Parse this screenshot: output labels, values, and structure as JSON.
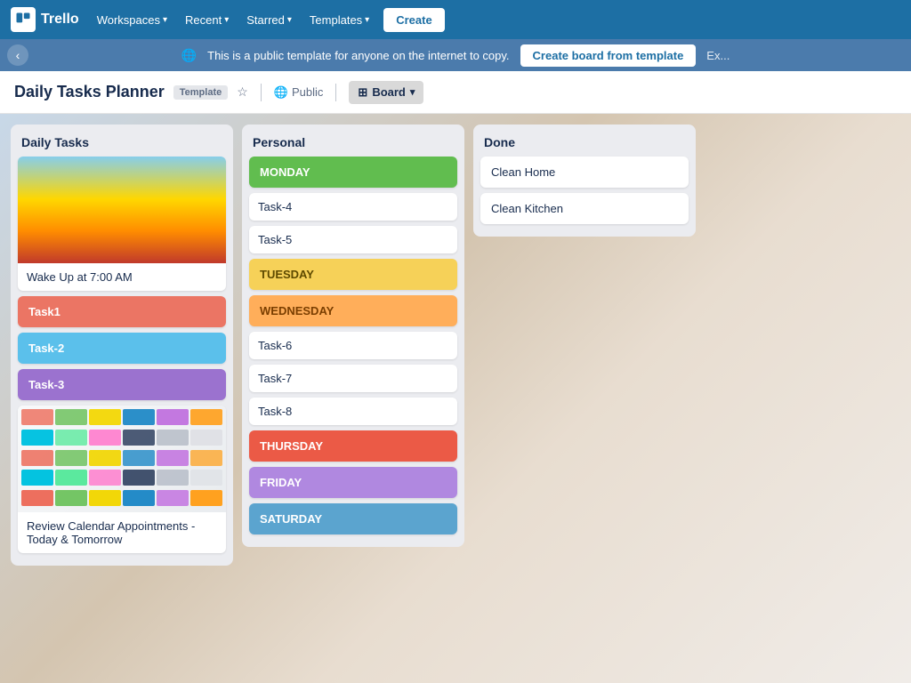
{
  "nav": {
    "logo_text": "Trello",
    "workspaces_label": "Workspaces",
    "recent_label": "Recent",
    "starred_label": "Starred",
    "templates_label": "Templates",
    "create_label": "Create"
  },
  "banner": {
    "icon": "🌐",
    "message": "This is a public template for anyone on the internet to copy.",
    "create_btn": "Create board from template",
    "extra": "Ex..."
  },
  "board_header": {
    "title": "Daily Tasks Planner",
    "template_badge": "Template",
    "visibility": "Public",
    "view": "Board"
  },
  "lists": [
    {
      "id": "daily-tasks",
      "title": "Daily Tasks",
      "cards": [
        {
          "type": "cover-text",
          "cover": "sunrise",
          "text": "Wake Up at 7:00 AM"
        },
        {
          "type": "colored",
          "color": "red",
          "text": "Task1"
        },
        {
          "type": "colored",
          "color": "cyan",
          "text": "Task-2"
        },
        {
          "type": "colored",
          "color": "purple",
          "text": "Task-3"
        },
        {
          "type": "cover-text",
          "cover": "notes",
          "text": "Review Calendar Appointments - Today & Tomorrow"
        }
      ]
    },
    {
      "id": "personal",
      "title": "Personal",
      "cards": [
        {
          "type": "day",
          "day": "monday",
          "text": "MONDAY"
        },
        {
          "type": "task",
          "text": "Task-4"
        },
        {
          "type": "task",
          "text": "Task-5"
        },
        {
          "type": "day",
          "day": "tuesday",
          "text": "TUESDAY"
        },
        {
          "type": "day",
          "day": "wednesday",
          "text": "WEDNESDAY"
        },
        {
          "type": "task",
          "text": "Task-6"
        },
        {
          "type": "task",
          "text": "Task-7"
        },
        {
          "type": "task",
          "text": "Task-8"
        },
        {
          "type": "day",
          "day": "thursday",
          "text": "THURSDAY"
        },
        {
          "type": "day",
          "day": "friday",
          "text": "FRIDAY"
        },
        {
          "type": "day",
          "day": "saturday",
          "text": "SATURDAY"
        }
      ]
    },
    {
      "id": "done",
      "title": "Done",
      "cards": [
        {
          "type": "done",
          "text": "Clean Home"
        },
        {
          "type": "done",
          "text": "Clean Kitchen"
        }
      ]
    }
  ],
  "sticky_colors": [
    "#eb5a46",
    "#61bd4f",
    "#f2d600",
    "#0079bf",
    "#c377e0",
    "#ff9f1a",
    "#00c2e0",
    "#51e898",
    "#ff78cb",
    "#344563",
    "#b3bac5",
    "#dfe1e6"
  ]
}
